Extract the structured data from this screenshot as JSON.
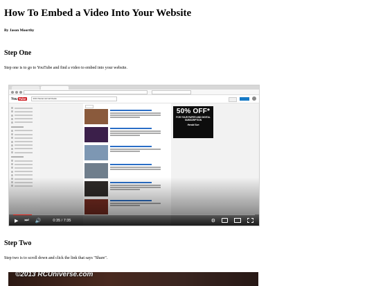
{
  "article": {
    "title": "How To Embed a Video Into Your Website",
    "author": "By Jason Moorthy",
    "steps": [
      {
        "heading": "Step One",
        "text": "Step one is to go to YouTube and find a video to embed into your website."
      },
      {
        "heading": "Step Two",
        "text": "Step two is to scroll down and click the link that says \"Share\"."
      }
    ]
  },
  "video1": {
    "youtube_logo_you": "You",
    "youtube_logo_tube": "Tube",
    "search_query": "2013 Model Aircraft Radio",
    "ad_headline": "50% OFF*",
    "ad_sub": "FOR YOUR PAPER AND DIGITAL SUBSCRIPTION",
    "ad_brand": "Herald Sun",
    "time": "0:35 / 7:35",
    "progress": 0.077,
    "progress_color": "#e62117"
  },
  "video2": {
    "watermark": "©2013 RCUniverse.com"
  }
}
